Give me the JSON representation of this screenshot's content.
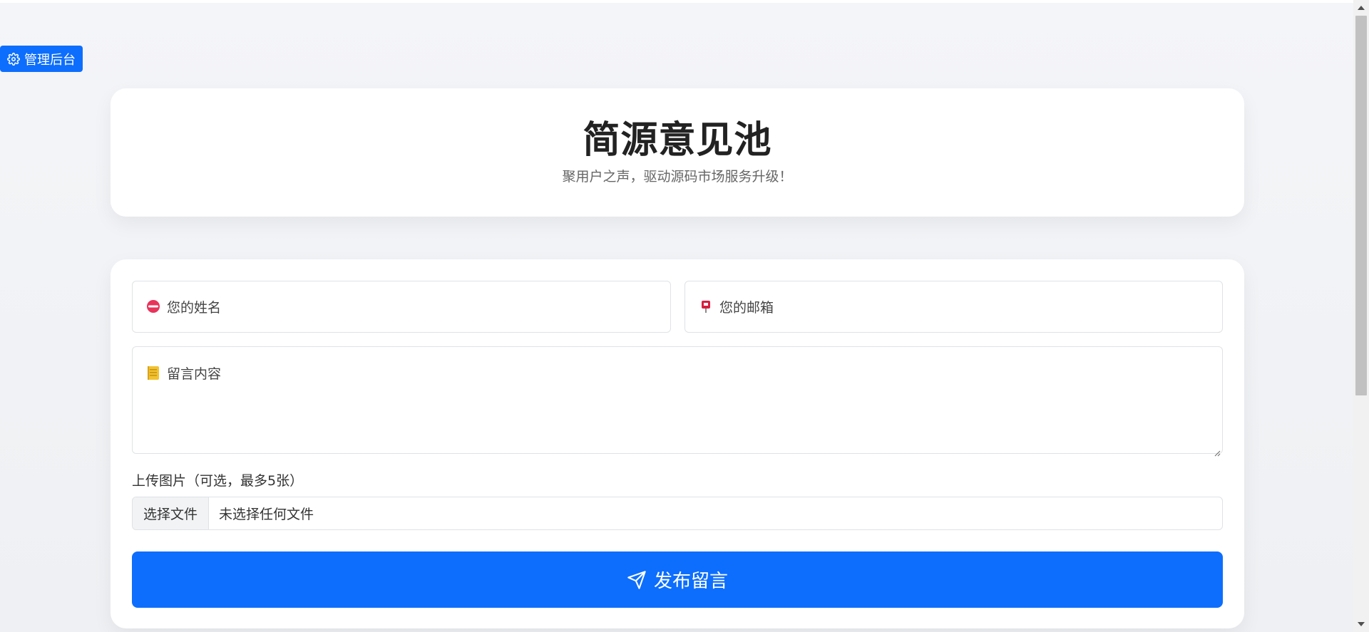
{
  "admin": {
    "label": "管理后台",
    "icon": "gear-icon"
  },
  "header": {
    "title": "简源意见池",
    "subtitle": "聚用户之声，驱动源码市场服务升级！"
  },
  "form": {
    "name_placeholder": "您的姓名",
    "name_icon": "lips-emoji-icon",
    "email_placeholder": "您的邮箱",
    "email_icon": "mailbox-emoji-icon",
    "message_placeholder": "留言内容",
    "message_icon": "notebook-emoji-icon",
    "upload_label": "上传图片（可选，最多5张）",
    "file_button": "选择文件",
    "file_status": "未选择任何文件",
    "submit_label": "发布留言",
    "submit_icon": "send-icon"
  },
  "colors": {
    "primary": "#0d6efd",
    "background": "#f3f4f7",
    "card": "#ffffff"
  }
}
